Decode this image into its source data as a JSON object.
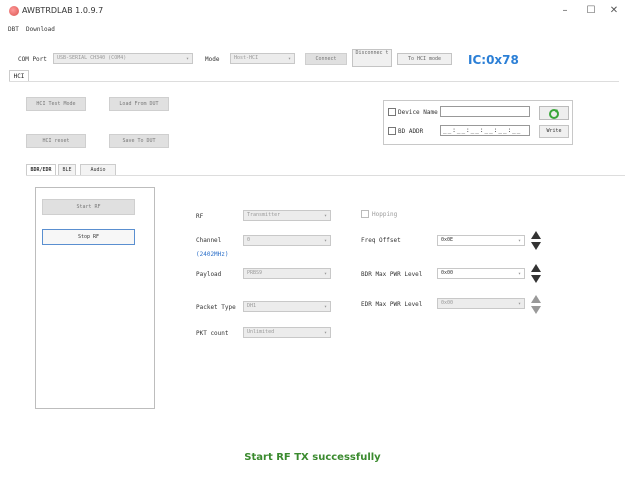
{
  "window": {
    "title": "AWBTRDLAB 1.0.9.7",
    "minimize": "–",
    "maximize": "☐",
    "close": "✕"
  },
  "menu": {
    "items": [
      "DBT",
      "Download"
    ]
  },
  "toolbar": {
    "com_port_label": "COM Port",
    "com_port_value": "USB-SERIAL CH340 (COM4)",
    "mode_label": "Mode",
    "mode_value": "Host-HCI",
    "connect_label": "Connect",
    "disconnect_label": "Disconnec t",
    "to_hci_mode_label": "To HCI mode",
    "ic_address": "IC:0x78"
  },
  "outer_tab": {
    "label": "HCI"
  },
  "hci_panel": {
    "hci_test_mode_label": "HCI Test Mode",
    "load_from_dut_label": "Load From DUT",
    "hci_reset_label": "HCI reset",
    "save_to_dut_label": "Save To DUT"
  },
  "device_group": {
    "device_name_label": "Device Name",
    "device_name_value": "",
    "bd_addr_label": "BD ADDR",
    "bd_addr_value": "__:__:__:__:__:__",
    "write_label": "Write"
  },
  "inner_tabs": [
    "BDR/EDR",
    "BLE",
    "Audio"
  ],
  "rf_controls": {
    "start_rf_label": "Start RF",
    "stop_rf_label": "Stop RF"
  },
  "rf_settings": {
    "rf_label": "RF",
    "rf_value": "Transmitter",
    "channel_label": "Channel",
    "channel_hint": "(2402MHz)",
    "channel_value": "0",
    "payload_label": "Payload",
    "payload_value": "PRBS9",
    "packet_type_label": "Packet Type",
    "packet_type_value": "DH1",
    "pkt_count_label": "PKT count",
    "pkt_count_value": "Unlimited",
    "hopping_label": "Hopping",
    "freq_offset_label": "Freq Offset",
    "freq_offset_value": "0x0E",
    "bdr_max_pwr_label": "BDR Max PWR Level",
    "bdr_max_pwr_value": "0x00",
    "edr_max_pwr_label": "EDR Max PWR Level",
    "edr_max_pwr_value": "0x00"
  },
  "status": {
    "message": "Start RF TX successfully"
  },
  "colors": {
    "ic_accent": "#2b7fd6",
    "status_green": "#3a8a2e",
    "active_button_border": "#5a8fd0"
  },
  "icons": {
    "refresh": "refresh-icon",
    "combo_arrow": "chevron-down-icon"
  }
}
